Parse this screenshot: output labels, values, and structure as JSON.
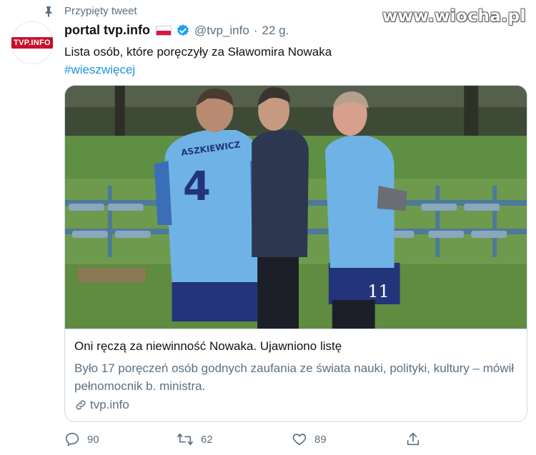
{
  "pinned": {
    "label": "Przypięty tweet",
    "icon": "pin-icon"
  },
  "watermark": "www.wiocha.pl",
  "author": {
    "avatar_text": "TVP.INFO",
    "name": "portal tvp.info",
    "handle": "@tvp_info",
    "separator": "·",
    "time": "22 g.",
    "verified_icon": "verified-badge-icon",
    "flag_icon": "poland-flag-icon"
  },
  "tweet": {
    "text": "Lista osób, które poręczyły za Sławomira Nowaka",
    "hashtag": "#wieszwięcej"
  },
  "card": {
    "title": "Oni ręczą za niewinność Nowaka. Ujawniono listę",
    "description": "Było 17 poręczeń osób godnych zaufania ze świata nauki, polityki, kultury – mówił pełnomocnik b. ministra.",
    "link": "tvp.info",
    "image_jersey_left": "4",
    "image_jersey_left_name": "ASZKIEWICZ",
    "image_jersey_right": "11"
  },
  "actions": {
    "reply_count": "90",
    "retweet_count": "62",
    "like_count": "89"
  },
  "colors": {
    "accent": "#1b95e0",
    "muted": "#5b7083",
    "verified": "#1da1f2",
    "tvp_red": "#c8102e"
  }
}
